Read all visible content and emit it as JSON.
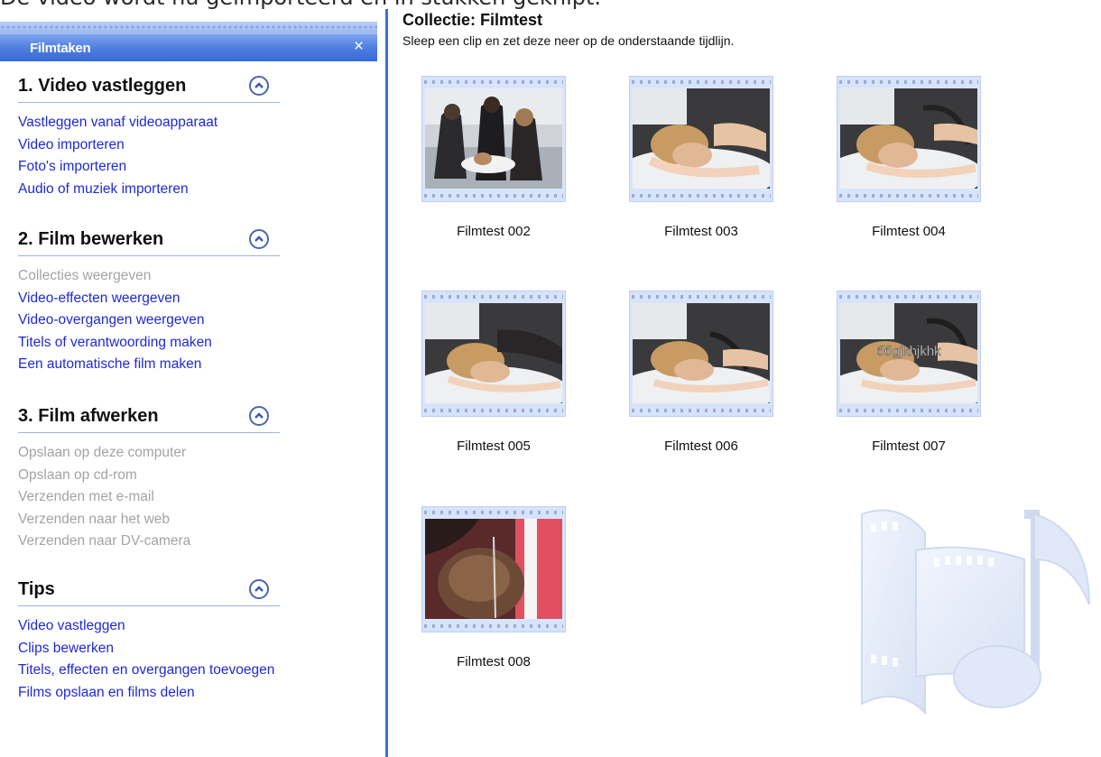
{
  "top_caption": "De video wordt nu geïmporteerd en in stukken geknipt.",
  "sidebar": {
    "pane_title": "Filmtaken",
    "close_symbol": "×",
    "sections": [
      {
        "title": "1. Video vastleggen",
        "links": [
          {
            "label": "Vastleggen vanaf videoapparaat",
            "enabled": true
          },
          {
            "label": "Video importeren",
            "enabled": true
          },
          {
            "label": "Foto's importeren",
            "enabled": true
          },
          {
            "label": "Audio of muziek importeren",
            "enabled": true
          }
        ]
      },
      {
        "title": "2. Film bewerken",
        "links": [
          {
            "label": "Collecties weergeven",
            "enabled": false
          },
          {
            "label": "Video-effecten weergeven",
            "enabled": true
          },
          {
            "label": "Video-overgangen weergeven",
            "enabled": true
          },
          {
            "label": "Titels of verantwoording maken",
            "enabled": true
          },
          {
            "label": "Een automatische film maken",
            "enabled": true
          }
        ]
      },
      {
        "title": "3. Film afwerken",
        "links": [
          {
            "label": "Opslaan op deze computer",
            "enabled": false
          },
          {
            "label": "Opslaan op cd-rom",
            "enabled": false
          },
          {
            "label": "Verzenden met e-mail",
            "enabled": false
          },
          {
            "label": "Verzenden naar het web",
            "enabled": false
          },
          {
            "label": "Verzenden naar DV-camera",
            "enabled": false
          }
        ]
      },
      {
        "title": "Tips",
        "links": [
          {
            "label": "Video vastleggen",
            "enabled": true
          },
          {
            "label": "Clips bewerken",
            "enabled": true
          },
          {
            "label": "Titels, effecten en overgangen toevoegen",
            "enabled": true
          },
          {
            "label": "Films opslaan en films delen",
            "enabled": true
          }
        ]
      }
    ]
  },
  "content": {
    "title": "Collectie: Filmtest",
    "subtitle": "Sleep een clip en zet deze neer op de onderstaande tijdlijn.",
    "clips": [
      {
        "label": "Filmtest 002",
        "overlay_text": ""
      },
      {
        "label": "Filmtest 003",
        "overlay_text": ""
      },
      {
        "label": "Filmtest 004",
        "overlay_text": ""
      },
      {
        "label": "Filmtest 005",
        "overlay_text": ""
      },
      {
        "label": "Filmtest 006",
        "overlay_text": ""
      },
      {
        "label": "Filmtest 007",
        "overlay_text": "ббgjkhjkhk"
      },
      {
        "label": "Filmtest 008",
        "overlay_text": ""
      }
    ]
  },
  "colors": {
    "link": "#1f29d6",
    "disabled_link": "#a3a3a3",
    "header_blue": "#3a6ad4",
    "divider_blue": "#3d6fd1"
  }
}
